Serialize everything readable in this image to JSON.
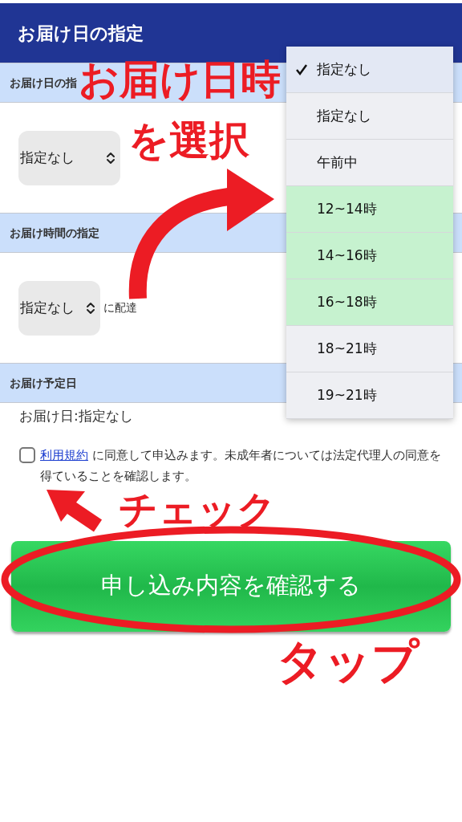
{
  "header": {
    "title": "お届け日の指定"
  },
  "sections": [
    {
      "kind": "select",
      "heading": "お届け日の指",
      "value": "指定なし"
    },
    {
      "kind": "select",
      "heading": "お届け時間の指定",
      "value": "指定なし",
      "suffix": "に配達"
    },
    {
      "kind": "text",
      "heading": "お届け予定日",
      "text": "お届け日:指定なし"
    }
  ],
  "agreement": {
    "checked": false,
    "link": "利用規約",
    "text": "に同意して申込みます。未成年者については法定代理人の同意を得ていることを確認します。"
  },
  "submit_button": {
    "label": "申し込み内容を確認する"
  },
  "dropdown": {
    "items": [
      {
        "label": "指定なし",
        "selected": true,
        "highlighted": false
      },
      {
        "label": "指定なし",
        "selected": false,
        "highlighted": false
      },
      {
        "label": "午前中",
        "selected": false,
        "highlighted": false
      },
      {
        "label": "12~14時",
        "selected": false,
        "highlighted": true
      },
      {
        "label": "14~16時",
        "selected": false,
        "highlighted": true
      },
      {
        "label": "16~18時",
        "selected": false,
        "highlighted": true
      },
      {
        "label": "18~21時",
        "selected": false,
        "highlighted": false
      },
      {
        "label": "19~21時",
        "selected": false,
        "highlighted": false
      }
    ]
  },
  "annotations": [
    {
      "kind": "caption",
      "text": "お届け日時"
    },
    {
      "kind": "caption",
      "text": "を選択"
    },
    {
      "kind": "caption",
      "text": "チェック"
    },
    {
      "kind": "caption",
      "text": "タップ"
    }
  ]
}
